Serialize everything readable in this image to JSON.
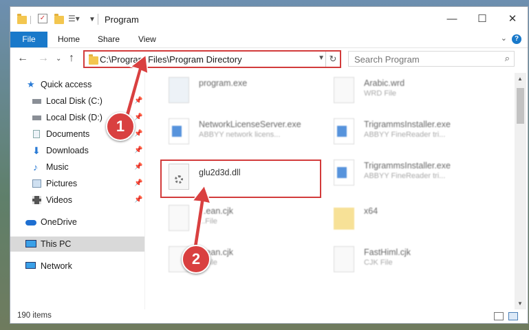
{
  "window": {
    "title": "Program"
  },
  "ribbon": {
    "tabs": [
      "File",
      "Home",
      "Share",
      "View"
    ]
  },
  "nav": {
    "address": "C:\\Program Files\\Program Directory",
    "search_placeholder": "Search Program"
  },
  "sidebar": {
    "items": [
      {
        "label": "Quick access",
        "icon": "star-icon",
        "pinned": false
      },
      {
        "label": "Local Disk (C:)",
        "icon": "drive-icon",
        "pinned": true
      },
      {
        "label": "Local Disk (D:)",
        "icon": "drive-icon",
        "pinned": true
      },
      {
        "label": "Documents",
        "icon": "documents-icon",
        "pinned": true
      },
      {
        "label": "Downloads",
        "icon": "download-icon",
        "pinned": true
      },
      {
        "label": "Music",
        "icon": "music-icon",
        "pinned": true
      },
      {
        "label": "Pictures",
        "icon": "pictures-icon",
        "pinned": true
      },
      {
        "label": "Videos",
        "icon": "videos-icon",
        "pinned": true
      },
      {
        "label": "OneDrive",
        "icon": "cloud-icon",
        "pinned": false
      },
      {
        "label": "This PC",
        "icon": "computer-icon",
        "pinned": false,
        "selected": true
      },
      {
        "label": "Network",
        "icon": "network-icon",
        "pinned": false
      }
    ]
  },
  "files": [
    {
      "name": "program.exe",
      "desc": ""
    },
    {
      "name": "Arabic.wrd",
      "desc": "WRD File"
    },
    {
      "name": "NetworkLicenseServer.exe",
      "desc": "ABBYY network licens..."
    },
    {
      "name": "TrigrammsInstaller.exe",
      "desc": "ABBYY FineReader tri..."
    },
    {
      "name": "glu2d3d.dll",
      "desc": ""
    },
    {
      "name": "TrigrammsInstaller.exe",
      "desc": "ABBYY FineReader tri..."
    },
    {
      "name": "...ean.cjk",
      "desc": "...File"
    },
    {
      "name": "x64",
      "desc": ""
    },
    {
      "name": "...ean.cjk",
      "desc": "...File"
    },
    {
      "name": "FastHiml.cjk",
      "desc": "CJK File"
    }
  ],
  "status": {
    "item_count": "190 items"
  },
  "annotations": {
    "step1": "1",
    "step2": "2"
  },
  "colors": {
    "accent": "#1979ca",
    "highlight": "#d23a3a"
  }
}
